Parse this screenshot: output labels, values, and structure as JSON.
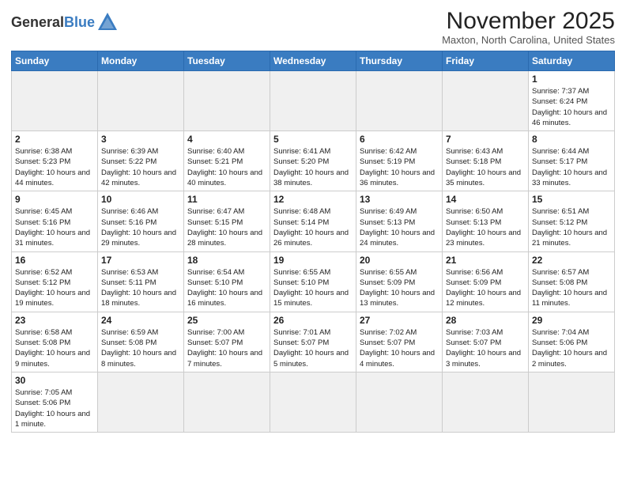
{
  "header": {
    "logo_general": "General",
    "logo_blue": "Blue",
    "month_title": "November 2025",
    "location": "Maxton, North Carolina, United States"
  },
  "days_of_week": [
    "Sunday",
    "Monday",
    "Tuesday",
    "Wednesday",
    "Thursday",
    "Friday",
    "Saturday"
  ],
  "weeks": [
    [
      {
        "day": "",
        "info": ""
      },
      {
        "day": "",
        "info": ""
      },
      {
        "day": "",
        "info": ""
      },
      {
        "day": "",
        "info": ""
      },
      {
        "day": "",
        "info": ""
      },
      {
        "day": "",
        "info": ""
      },
      {
        "day": "1",
        "info": "Sunrise: 7:37 AM\nSunset: 6:24 PM\nDaylight: 10 hours and 46 minutes."
      }
    ],
    [
      {
        "day": "2",
        "info": "Sunrise: 6:38 AM\nSunset: 5:23 PM\nDaylight: 10 hours and 44 minutes."
      },
      {
        "day": "3",
        "info": "Sunrise: 6:39 AM\nSunset: 5:22 PM\nDaylight: 10 hours and 42 minutes."
      },
      {
        "day": "4",
        "info": "Sunrise: 6:40 AM\nSunset: 5:21 PM\nDaylight: 10 hours and 40 minutes."
      },
      {
        "day": "5",
        "info": "Sunrise: 6:41 AM\nSunset: 5:20 PM\nDaylight: 10 hours and 38 minutes."
      },
      {
        "day": "6",
        "info": "Sunrise: 6:42 AM\nSunset: 5:19 PM\nDaylight: 10 hours and 36 minutes."
      },
      {
        "day": "7",
        "info": "Sunrise: 6:43 AM\nSunset: 5:18 PM\nDaylight: 10 hours and 35 minutes."
      },
      {
        "day": "8",
        "info": "Sunrise: 6:44 AM\nSunset: 5:17 PM\nDaylight: 10 hours and 33 minutes."
      }
    ],
    [
      {
        "day": "9",
        "info": "Sunrise: 6:45 AM\nSunset: 5:16 PM\nDaylight: 10 hours and 31 minutes."
      },
      {
        "day": "10",
        "info": "Sunrise: 6:46 AM\nSunset: 5:16 PM\nDaylight: 10 hours and 29 minutes."
      },
      {
        "day": "11",
        "info": "Sunrise: 6:47 AM\nSunset: 5:15 PM\nDaylight: 10 hours and 28 minutes."
      },
      {
        "day": "12",
        "info": "Sunrise: 6:48 AM\nSunset: 5:14 PM\nDaylight: 10 hours and 26 minutes."
      },
      {
        "day": "13",
        "info": "Sunrise: 6:49 AM\nSunset: 5:13 PM\nDaylight: 10 hours and 24 minutes."
      },
      {
        "day": "14",
        "info": "Sunrise: 6:50 AM\nSunset: 5:13 PM\nDaylight: 10 hours and 23 minutes."
      },
      {
        "day": "15",
        "info": "Sunrise: 6:51 AM\nSunset: 5:12 PM\nDaylight: 10 hours and 21 minutes."
      }
    ],
    [
      {
        "day": "16",
        "info": "Sunrise: 6:52 AM\nSunset: 5:12 PM\nDaylight: 10 hours and 19 minutes."
      },
      {
        "day": "17",
        "info": "Sunrise: 6:53 AM\nSunset: 5:11 PM\nDaylight: 10 hours and 18 minutes."
      },
      {
        "day": "18",
        "info": "Sunrise: 6:54 AM\nSunset: 5:10 PM\nDaylight: 10 hours and 16 minutes."
      },
      {
        "day": "19",
        "info": "Sunrise: 6:55 AM\nSunset: 5:10 PM\nDaylight: 10 hours and 15 minutes."
      },
      {
        "day": "20",
        "info": "Sunrise: 6:55 AM\nSunset: 5:09 PM\nDaylight: 10 hours and 13 minutes."
      },
      {
        "day": "21",
        "info": "Sunrise: 6:56 AM\nSunset: 5:09 PM\nDaylight: 10 hours and 12 minutes."
      },
      {
        "day": "22",
        "info": "Sunrise: 6:57 AM\nSunset: 5:08 PM\nDaylight: 10 hours and 11 minutes."
      }
    ],
    [
      {
        "day": "23",
        "info": "Sunrise: 6:58 AM\nSunset: 5:08 PM\nDaylight: 10 hours and 9 minutes."
      },
      {
        "day": "24",
        "info": "Sunrise: 6:59 AM\nSunset: 5:08 PM\nDaylight: 10 hours and 8 minutes."
      },
      {
        "day": "25",
        "info": "Sunrise: 7:00 AM\nSunset: 5:07 PM\nDaylight: 10 hours and 7 minutes."
      },
      {
        "day": "26",
        "info": "Sunrise: 7:01 AM\nSunset: 5:07 PM\nDaylight: 10 hours and 5 minutes."
      },
      {
        "day": "27",
        "info": "Sunrise: 7:02 AM\nSunset: 5:07 PM\nDaylight: 10 hours and 4 minutes."
      },
      {
        "day": "28",
        "info": "Sunrise: 7:03 AM\nSunset: 5:07 PM\nDaylight: 10 hours and 3 minutes."
      },
      {
        "day": "29",
        "info": "Sunrise: 7:04 AM\nSunset: 5:06 PM\nDaylight: 10 hours and 2 minutes."
      }
    ],
    [
      {
        "day": "30",
        "info": "Sunrise: 7:05 AM\nSunset: 5:06 PM\nDaylight: 10 hours and 1 minute."
      },
      {
        "day": "",
        "info": ""
      },
      {
        "day": "",
        "info": ""
      },
      {
        "day": "",
        "info": ""
      },
      {
        "day": "",
        "info": ""
      },
      {
        "day": "",
        "info": ""
      },
      {
        "day": "",
        "info": ""
      }
    ]
  ]
}
